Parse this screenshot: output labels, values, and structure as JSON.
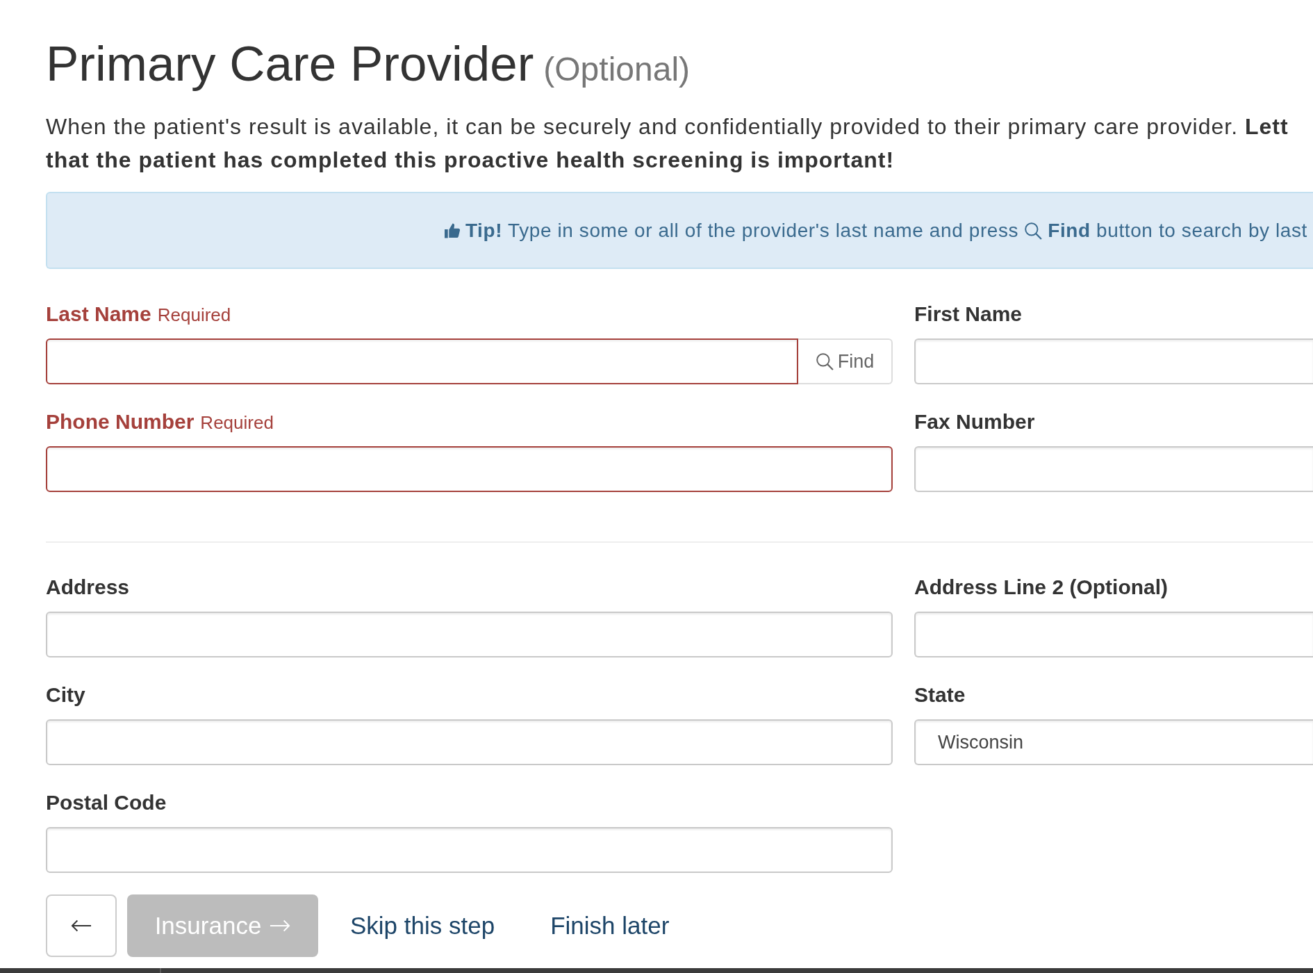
{
  "heading": {
    "title": "Primary Care Provider",
    "note": "(Optional)"
  },
  "intro": "When the patient's result is available, it can be securely and confidentially provided to their primary care provider. **Lett that the patient has completed this proactive health screening is important!**",
  "tip": {
    "lead": "**Tip!** Type in some or all of the provider's last name and press",
    "tail": "**Find** button to search by last"
  },
  "field_groups": [
    {
      "fields": [
        {
          "label": "Last Name",
          "required": true,
          "note": "Required",
          "button": "Find"
        },
        {
          "label": "First Name",
          "required": false
        },
        {
          "label": "Phone Number",
          "required": true,
          "note": "Required"
        },
        {
          "label": "Fax Number",
          "required": false
        }
      ]
    },
    {
      "fields": [
        {
          "label": "Address",
          "required": false
        },
        {
          "label": "Address Line 2 (Optional)",
          "required": false
        },
        {
          "label": "City",
          "required": false
        },
        {
          "label": "State",
          "required": false,
          "value": "Wisconsin"
        },
        {
          "label": "Postal Code",
          "required": false
        }
      ]
    }
  ],
  "actions": [
    {
      "kind": "back"
    },
    {
      "kind": "next",
      "label": "Insurance",
      "disabled": true
    },
    {
      "kind": "link",
      "label": "Skip this step"
    },
    {
      "kind": "link",
      "label": "Finish later"
    }
  ]
}
